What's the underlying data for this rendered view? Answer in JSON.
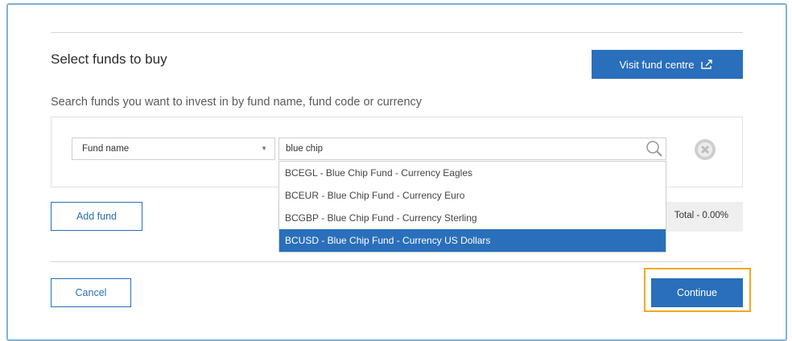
{
  "header": {
    "title": "Select funds to buy",
    "visit_button_label": "Visit fund centre",
    "subtitle": "Search funds you want to invest in by fund name, fund code or currency"
  },
  "search": {
    "filter_selected": "Fund name",
    "query": "blue chip",
    "results": [
      "BCEGL - Blue Chip Fund - Currency Eagles",
      "BCEUR - Blue Chip Fund - Currency Euro",
      "BCGBP - Blue Chip Fund - Currency Sterling",
      "BCUSD - Blue Chip Fund - Currency US Dollars"
    ],
    "highlighted_index": 3
  },
  "actions": {
    "add_fund_label": "Add fund",
    "total_label": "Total - 0.00%",
    "cancel_label": "Cancel",
    "continue_label": "Continue"
  },
  "icons": {
    "visit": "external-link-icon",
    "search": "search-icon",
    "clear": "clear-circle-icon",
    "caret": "chevron-down-icon"
  },
  "colors": {
    "primary": "#2a6fbb",
    "highlight": "#f2a81d",
    "frame": "#7fb0d9"
  }
}
